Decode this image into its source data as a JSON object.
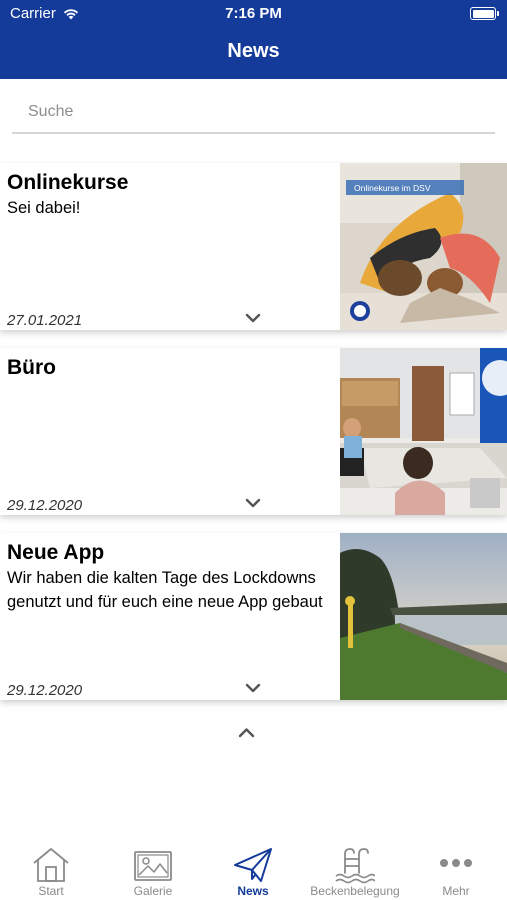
{
  "status_bar": {
    "carrier": "Carrier",
    "time": "7:16 PM"
  },
  "header": {
    "title": "News"
  },
  "search": {
    "placeholder": "Suche",
    "value": ""
  },
  "news": [
    {
      "title": "Onlinekurse",
      "text": "Sei dabei!",
      "date": "27.01.2021",
      "image_caption": "Onlinekurse im DSV"
    },
    {
      "title": "Büro",
      "text": "",
      "date": "29.12.2020"
    },
    {
      "title": "Neue App",
      "text": "Wir haben die kalten Tage des Lockdowns genutzt und für euch eine neue App gebaut",
      "date": "29.12.2020"
    }
  ],
  "tabbar": {
    "items": [
      {
        "label": "Start",
        "icon": "home-icon"
      },
      {
        "label": "Galerie",
        "icon": "gallery-icon"
      },
      {
        "label": "News",
        "icon": "paper-plane-icon",
        "active": true
      },
      {
        "label": "Beckenbelegung",
        "icon": "pool-ladder-icon"
      },
      {
        "label": "Mehr",
        "icon": "more-icon"
      }
    ]
  },
  "colors": {
    "primary": "#143a9a",
    "inactive": "#8a8a8a"
  }
}
